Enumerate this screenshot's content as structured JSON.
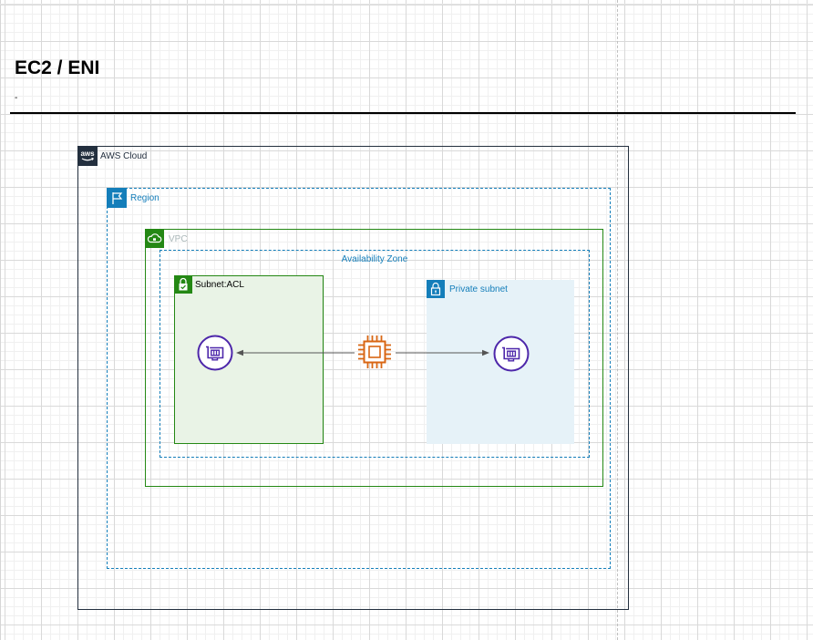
{
  "page": {
    "title": "EC2 / ENI",
    "subtitle": "-"
  },
  "groups": {
    "aws_cloud": {
      "label": "AWS Cloud",
      "color": "#232f3e",
      "icon": "aws-logo-icon"
    },
    "region": {
      "label": "Region",
      "color": "#147eba",
      "icon": "region-flag-icon"
    },
    "vpc": {
      "label": "VPC",
      "color": "#248814",
      "label_color": "#aab7b8",
      "icon": "vpc-cloud-icon"
    },
    "availability_zone": {
      "label": "Availability Zone",
      "color": "#147eba"
    },
    "subnet_acl": {
      "label": "Subnet:ACL",
      "color": "#248814",
      "fill": "#e9f3e6",
      "icon": "lock-icon"
    },
    "private_subnet": {
      "label": "Private subnet",
      "color": "#147eba",
      "fill": "#e6f2f8",
      "icon": "lock-icon"
    }
  },
  "nodes": {
    "eni_left": {
      "icon": "elastic-network-interface-icon",
      "color": "#4d27aa"
    },
    "ec2": {
      "icon": "ec2-instance-icon",
      "color": "#d86613"
    },
    "eni_right": {
      "icon": "elastic-network-interface-icon",
      "color": "#4d27aa"
    }
  },
  "edges": [
    {
      "from": "ec2",
      "to": "eni_left"
    },
    {
      "from": "ec2",
      "to": "eni_right"
    }
  ]
}
